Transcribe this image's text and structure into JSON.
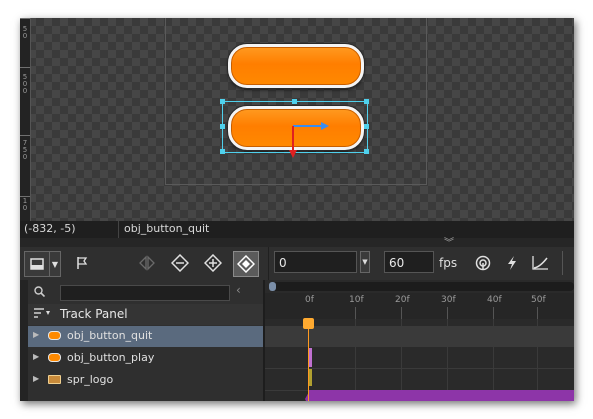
{
  "canvas": {
    "ruler_ticks": [
      {
        "digits": [
          "5",
          "0"
        ]
      },
      {
        "digits": [
          "5",
          "0",
          "0"
        ]
      },
      {
        "digits": [
          "7",
          "5",
          "0"
        ]
      },
      {
        "digits": [
          "1",
          "0"
        ]
      }
    ],
    "objects": [
      {
        "name": "obj_button_play",
        "color": "#ff8000"
      },
      {
        "name": "obj_button_quit",
        "color": "#ff8000",
        "selected": true
      }
    ],
    "gizmo_colors": {
      "x_axis": "#3a8df0",
      "y_axis": "#e02020",
      "selection": "#4fd0ec"
    }
  },
  "statusbar": {
    "coords": "(-832, -5)",
    "object_name": "obj_button_quit"
  },
  "toolbar": {
    "frame_value": "0",
    "fps_value": "60",
    "fps_label": "fps",
    "icons": [
      "view-mode-icon",
      "dropdown-icon",
      "flag-icon",
      "previous-key-icon",
      "remove-key-icon",
      "add-key-icon",
      "key-mode-icon",
      "onion-skin-icon",
      "quick-key-icon",
      "curve-icon"
    ]
  },
  "track_panel": {
    "title": "Track Panel",
    "search_placeholder": "",
    "tracks": [
      {
        "label": "obj_button_quit",
        "icon": "object-icon",
        "selected": true
      },
      {
        "label": "obj_button_play",
        "icon": "object-icon",
        "selected": false
      },
      {
        "label": "spr_logo",
        "icon": "sprite-icon",
        "selected": false
      }
    ]
  },
  "timeline": {
    "frame_labels": [
      "0f",
      "10f",
      "20f",
      "30f",
      "40f",
      "50f"
    ],
    "playhead_frame": 0,
    "colors": {
      "track_bar": "#8d35a8",
      "playhead": "#ff9a20"
    }
  }
}
